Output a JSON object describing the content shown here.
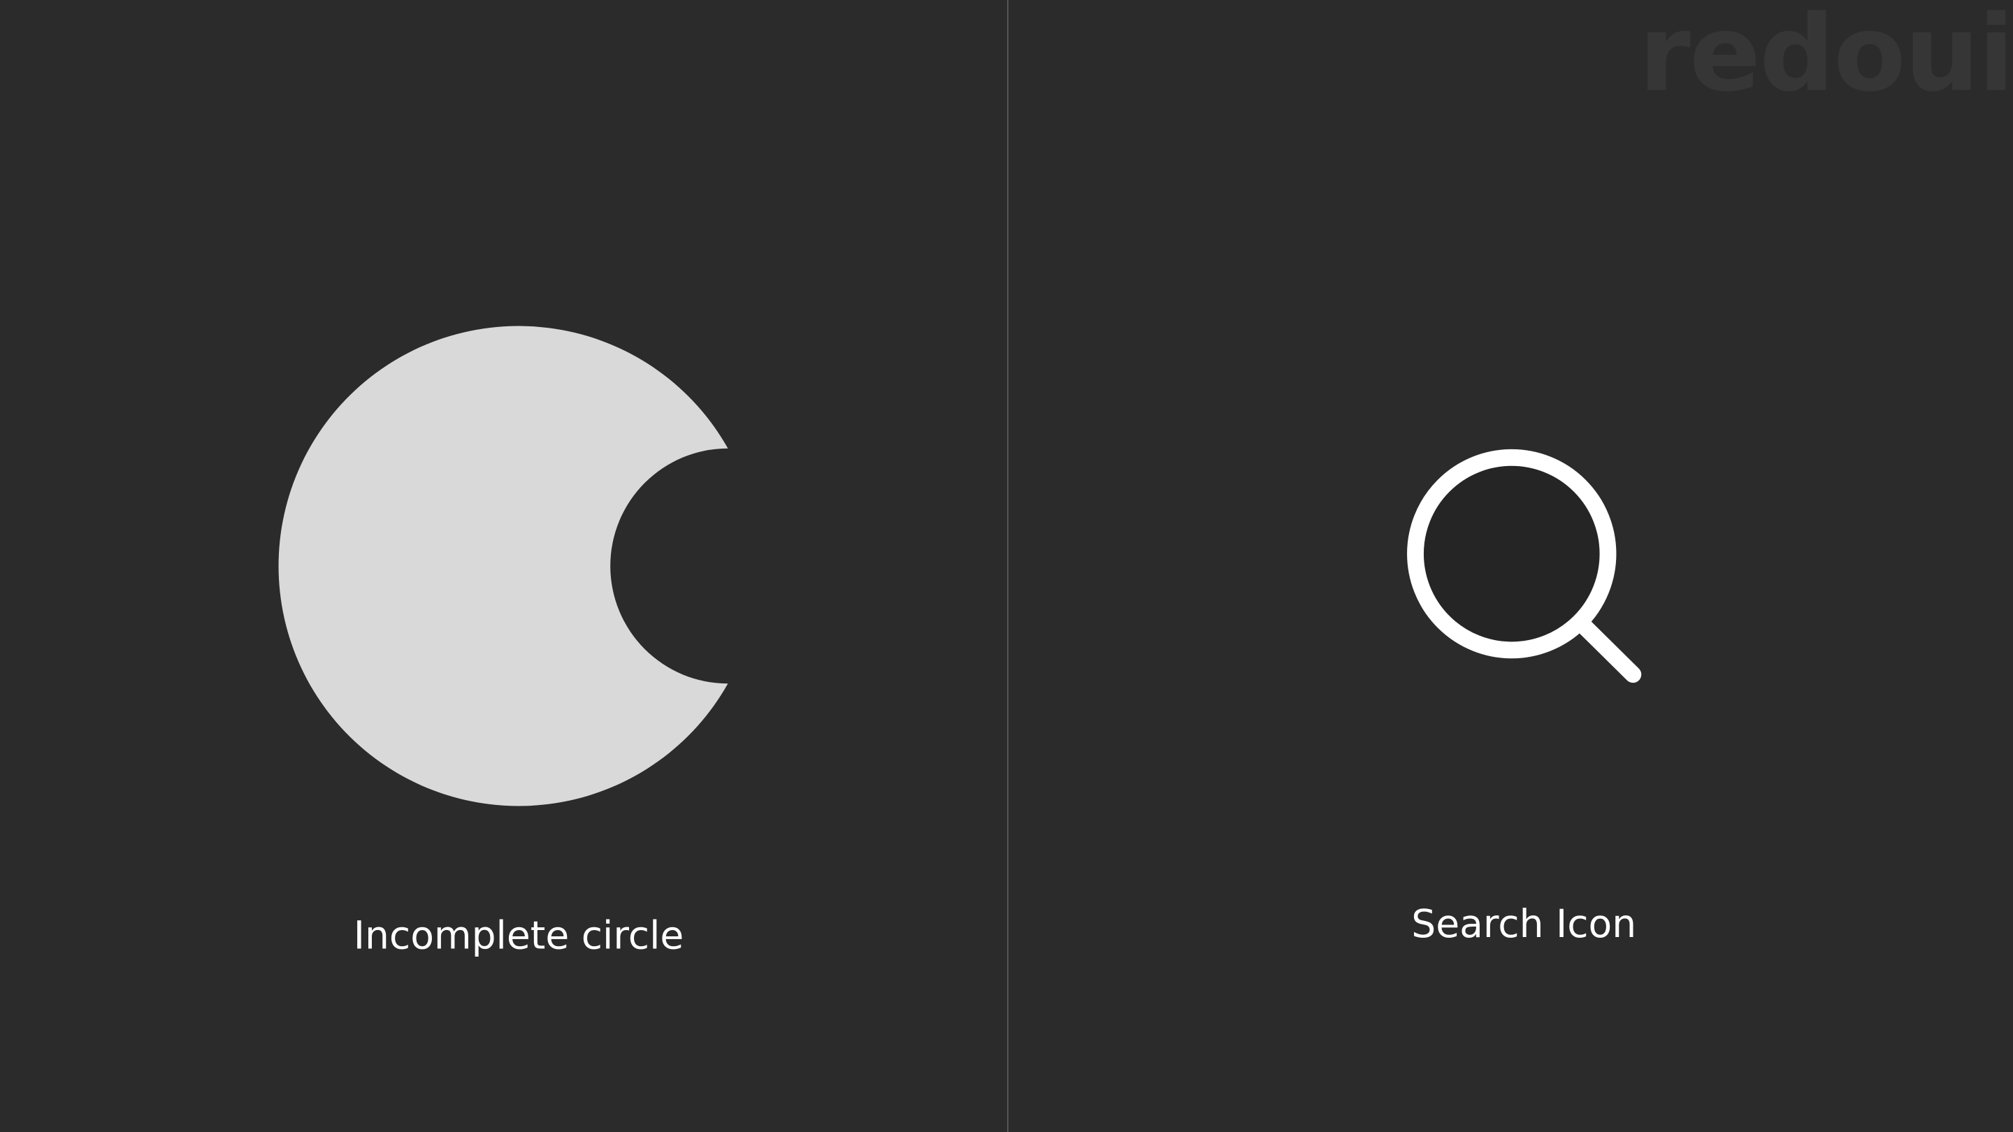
{
  "watermark": "redoui",
  "left_panel": {
    "label": "Incomplete circle",
    "shape_color": "#d9d9d9"
  },
  "right_panel": {
    "label": "Search Icon",
    "icon": "search-icon",
    "icon_color": "#ffffff",
    "icon_fill": "#252525"
  },
  "colors": {
    "background": "#2b2b2b",
    "divider": "#5a5a5a"
  }
}
